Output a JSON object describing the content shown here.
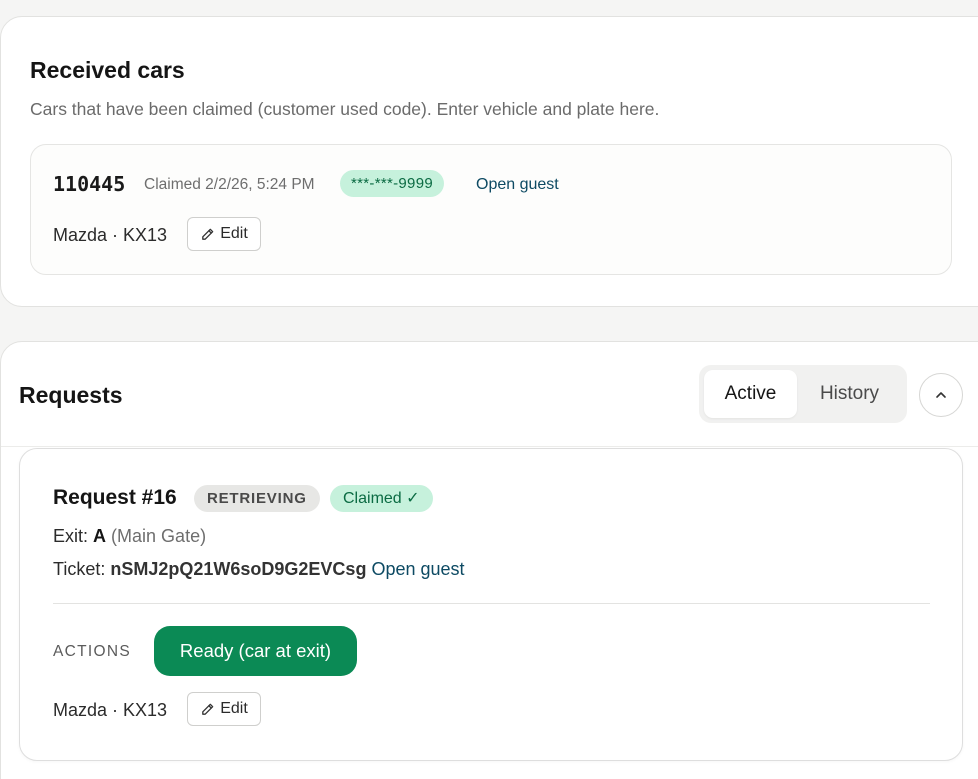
{
  "received": {
    "title": "Received cars",
    "subtitle": "Cars that have been claimed (customer used code). Enter vehicle and plate here.",
    "car": {
      "code": "110445",
      "claimed": "Claimed 2/2/26, 5:24 PM",
      "phone": "***-***-9999",
      "open_guest": "Open guest",
      "vehicle": "Mazda · KX13",
      "edit_label": "Edit"
    }
  },
  "requests": {
    "title": "Requests",
    "tabs": [
      {
        "label": "Active",
        "active": true
      },
      {
        "label": "History",
        "active": false
      }
    ],
    "request": {
      "title": "Request #16",
      "status": "RETRIEVING",
      "claimed_badge": "Claimed ✓",
      "exit_label": "Exit:",
      "exit_value": "A",
      "exit_detail": "(Main Gate)",
      "ticket_label": "Ticket:",
      "ticket_value": "nSMJ2pQ21W6soD9G2EVCsg",
      "open_guest": "Open guest",
      "actions_label": "ACTIONS",
      "ready_label": "Ready (car at exit)",
      "vehicle": "Mazda · KX13",
      "edit_label": "Edit"
    }
  },
  "colors": {
    "accent_green": "#0b8a55",
    "badge_green_bg": "#c6f1dc",
    "link": "#0d4a63"
  },
  "icons": {
    "edit": "pencil-icon",
    "collapse": "chevron-up-icon"
  }
}
